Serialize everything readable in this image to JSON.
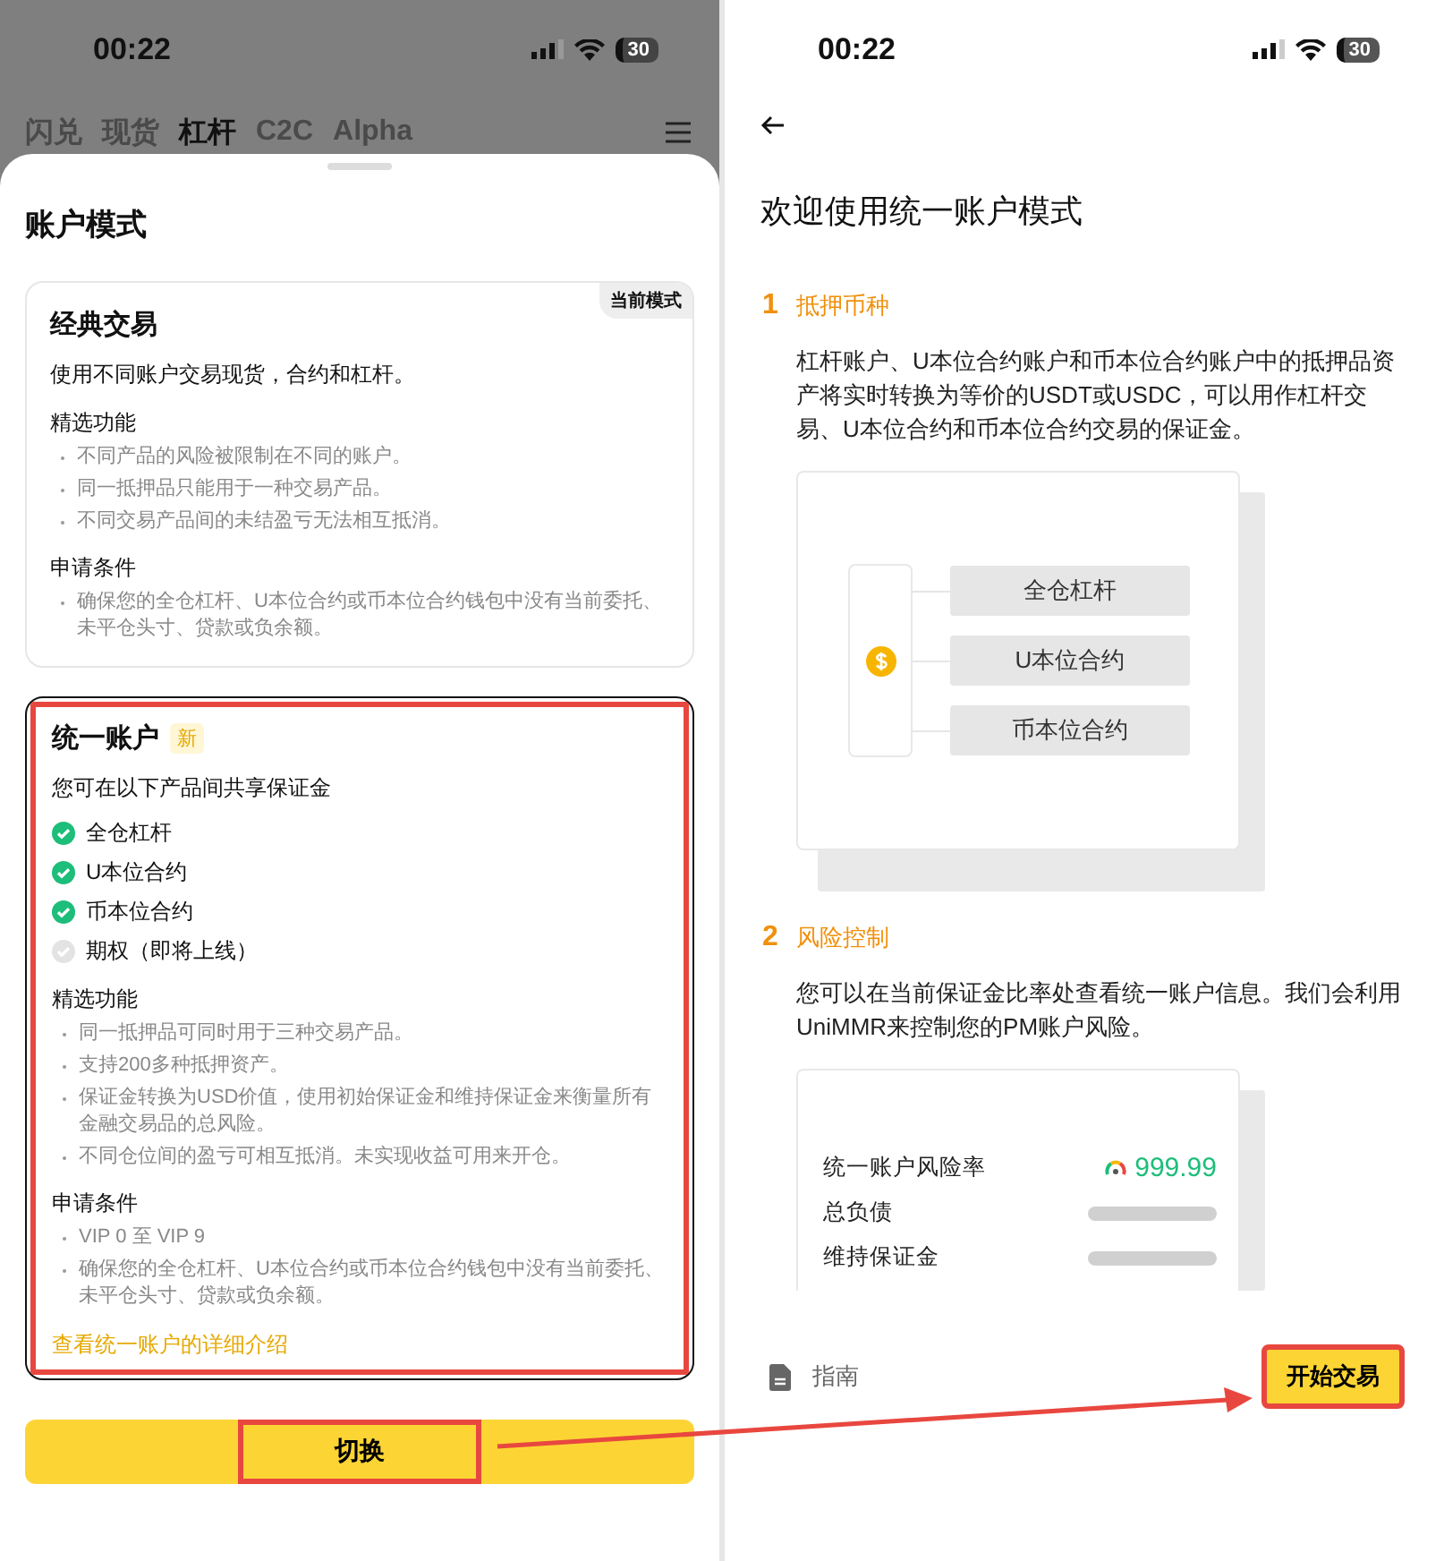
{
  "left": {
    "status_bar": {
      "time": "00:22",
      "battery": "30"
    },
    "tabs": [
      {
        "label": "闪兑",
        "selected": false
      },
      {
        "label": "现货",
        "selected": false
      },
      {
        "label": "杠杆",
        "selected": true
      },
      {
        "label": "C2C",
        "selected": false
      },
      {
        "label": "Alpha",
        "selected": false
      }
    ],
    "sheet": {
      "title": "账户模式",
      "cards": [
        {
          "title": "经典交易",
          "badge": "当前模式",
          "kind": "corner",
          "selected": false,
          "highlighted": false,
          "description": "使用不同账户交易现货，合约和杠杆。",
          "sections": [
            {
              "heading": "精选功能",
              "bullets": [
                "不同产品的风险被限制在不同的账户。",
                "同一抵押品只能用于一种交易产品。",
                "不同交易产品间的未结盈亏无法相互抵消。"
              ]
            },
            {
              "heading": "申请条件",
              "bullets": [
                "确保您的全仓杠杆、U本位合约或币本位合约钱包中没有当前委托、未平仓头寸、贷款或负余额。"
              ]
            }
          ]
        },
        {
          "title": "统一账户",
          "badge": "新",
          "kind": "inline",
          "selected": true,
          "highlighted": true,
          "description": "您可在以下产品间共享保证金",
          "products": [
            {
              "label": "全仓杠杆",
              "available": true
            },
            {
              "label": "U本位合约",
              "available": true
            },
            {
              "label": "币本位合约",
              "available": true
            },
            {
              "label": "期权（即将上线）",
              "available": false
            }
          ],
          "sections": [
            {
              "heading": "精选功能",
              "bullets": [
                "同一抵押品可同时用于三种交易产品。",
                "支持200多种抵押资产。",
                "保证金转换为USD价值，使用初始保证金和维持保证金来衡量所有金融交易品的总风险。",
                "不同仓位间的盈亏可相互抵消。未实现收益可用来开仓。"
              ]
            },
            {
              "heading": "申请条件",
              "bullets": [
                "VIP 0 至 VIP 9",
                "确保您的全仓杠杆、U本位合约或币本位合约钱包中没有当前委托、未平仓头寸、贷款或负余额。"
              ]
            }
          ],
          "link": "查看统一账户的详细介绍"
        }
      ]
    },
    "switch_button": {
      "label": "切换",
      "highlighted": true
    }
  },
  "right": {
    "status_bar": {
      "time": "00:22",
      "battery": "30"
    },
    "title": "欢迎使用统一账户模式",
    "steps": [
      {
        "number": "1",
        "title": "抵押币种",
        "text": "杠杆账户、U本位合约账户和币本位合约账户中的抵押品资产将实时转换为等价的USDT或USDC，可以用作杠杆交易、U本位合约和币本位合约交易的保证金。",
        "kind": "collateral",
        "items": [
          "全仓杠杆",
          "U本位合约",
          "币本位合约"
        ]
      },
      {
        "number": "2",
        "title": "风险控制",
        "text": "您可以在当前保证金比率处查看统一账户信息。我们会利用UniMMR来控制您的PM账户风险。",
        "kind": "risk",
        "rows": [
          {
            "label": "统一账户风险率",
            "value": "999.99"
          },
          {
            "label": "总负债"
          },
          {
            "label": "维持保证金"
          }
        ]
      }
    ],
    "guide_link": "指南",
    "start_button": {
      "label": "开始交易",
      "highlighted": true
    }
  }
}
